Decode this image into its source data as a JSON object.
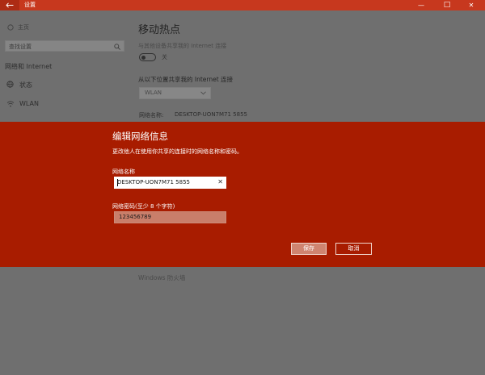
{
  "window": {
    "title": "设置",
    "controls": {
      "minimize": "—",
      "maximize": "□",
      "close": "✕"
    }
  },
  "sidebar": {
    "home": "主页",
    "search_placeholder": "查找设置",
    "section_title": "网络和 Internet",
    "items": [
      {
        "label": "状态",
        "icon": "globe-icon"
      },
      {
        "label": "WLAN",
        "icon": "wifi-icon"
      }
    ]
  },
  "main": {
    "title": "移动热点",
    "share_description": "与其他设备共享我的 Internet 连接",
    "toggle_state": "关",
    "connection_label": "从以下位置共享我的 Internet 连接",
    "connection_value": "WLAN",
    "network_name_label": "网络名称:",
    "network_name_value": "DESKTOP-UON7M71 5855",
    "firewall": "Windows 防火墙"
  },
  "dialog": {
    "title": "编辑网络信息",
    "description": "更改他人在使用你共享的连接时的网络名称和密码。",
    "name_label": "网络名称",
    "name_value": "DESKTOP-UON7M71 5855",
    "password_label": "网络密码(至少 8 个字符)",
    "password_value": "123456789",
    "save_label": "保存",
    "cancel_label": "取消"
  },
  "colors": {
    "titlebar": "#c7381e",
    "dialog_bg": "#a81c00",
    "overlay": "#6f6f6f"
  }
}
